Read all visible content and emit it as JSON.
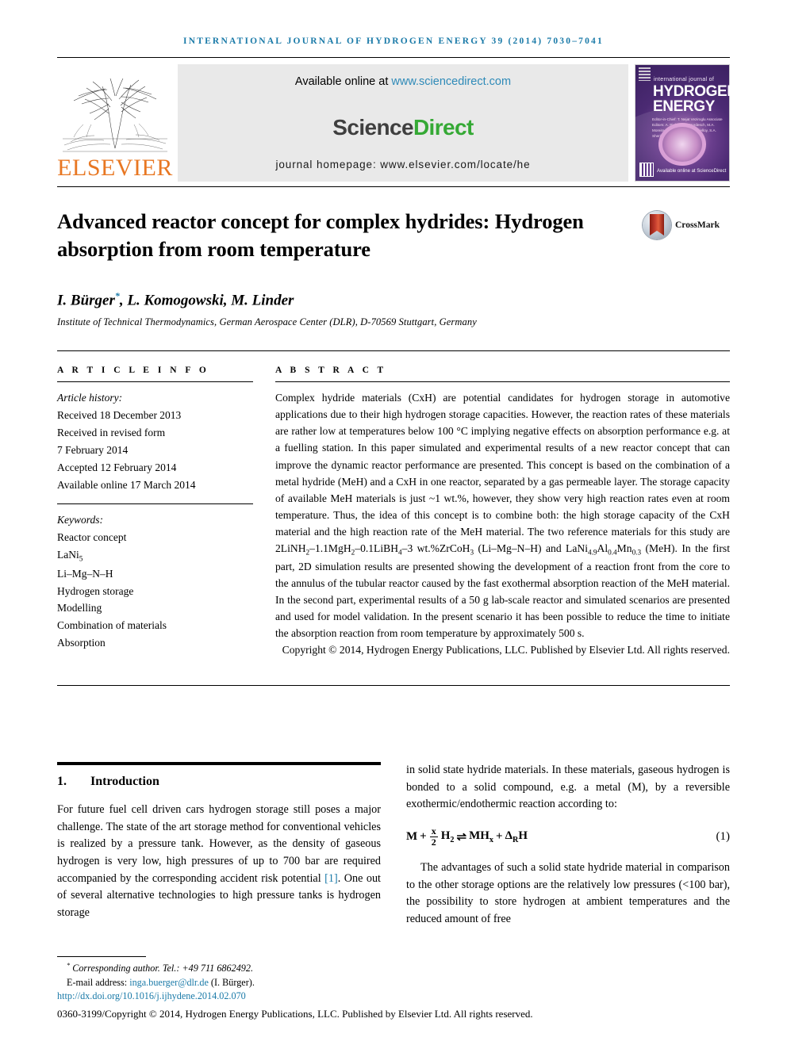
{
  "running_head": "International Journal of Hydrogen Energy 39 (2014) 7030–7041",
  "masthead": {
    "publisher_name": "ELSEVIER",
    "available_prefix": "Available online at ",
    "sciencedirect_url": "www.sciencedirect.com",
    "logo_part1": "Science",
    "logo_part2": "Direct",
    "journal_homepage": "journal homepage: www.elsevier.com/locate/he",
    "cover": {
      "line_small": "international journal of",
      "line1": "HYDROGEN",
      "line2": "ENERGY",
      "editors": "Editor-in-Chief: T. Nejat Veziroglu   Associate Editors: A. Bielsk, E.C. Kordesch, M.A. Moreira, M.Z. Pasche, J.M. Bielloy, S.A. Sherif and D.Y. Goswami",
      "sd_note": "Available online at ScienceDirect"
    }
  },
  "title": "Advanced reactor concept for complex hydrides: Hydrogen absorption from room temperature",
  "crossmark_label": "CrossMark",
  "authors": "I. Bürger",
  "authors_rest": ", L. Komogowski, M. Linder",
  "author_marker": "*",
  "affiliation": "Institute of Technical Thermodynamics, German Aerospace Center (DLR), D-70569 Stuttgart, Germany",
  "article_info": {
    "heading": "A R T I C L E   I N F O",
    "history_label": "Article history:",
    "history": [
      "Received 18 December 2013",
      "Received in revised form",
      "7 February 2014",
      "Accepted 12 February 2014",
      "Available online 17 March 2014"
    ],
    "keywords_label": "Keywords:",
    "keywords": [
      "Reactor concept",
      "LaNi5",
      "Li–Mg–N–H",
      "Hydrogen storage",
      "Modelling",
      "Combination of materials",
      "Absorption"
    ]
  },
  "abstract": {
    "heading": "A B S T R A C T",
    "body": "Complex hydride materials (CxH) are potential candidates for hydrogen storage in automotive applications due to their high hydrogen storage capacities. However, the reaction rates of these materials are rather low at temperatures below 100 °C implying negative effects on absorption performance e.g. at a fuelling station. In this paper simulated and experimental results of a new reactor concept that can improve the dynamic reactor performance are presented. This concept is based on the combination of a metal hydride (MeH) and a CxH in one reactor, separated by a gas permeable layer. The storage capacity of available MeH materials is just ~1 wt.%, however, they show very high reaction rates even at room temperature. Thus, the idea of this concept is to combine both: the high storage capacity of the CxH material and the high reaction rate of the MeH material. The two reference materials for this study are 2LiNH2–1.1MgH2–0.1LiBH4–3 wt.%ZrCoH3 (Li–Mg–N–H) and LaNi4.9Al0.4Mn0.3 (MeH). In the first part, 2D simulation results are presented showing the development of a reaction front from the core to the annulus of the tubular reactor caused by the fast exothermal absorption reaction of the MeH material. In the second part, experimental results of a 50 g lab-scale reactor and simulated scenarios are presented and used for model validation. In the present scenario it has been possible to reduce the time to initiate the absorption reaction from room temperature by approximately 500 s.",
    "copyright": "Copyright © 2014, Hydrogen Energy Publications, LLC. Published by Elsevier Ltd. All rights reserved."
  },
  "section": {
    "number": "1.",
    "title": "Introduction"
  },
  "body": {
    "left_p1_a": "For future fuel cell driven cars hydrogen storage still poses a major challenge. The state of the art storage method for conventional vehicles is realized by a pressure tank. However, as the density of gaseous hydrogen is very low, high pressures of up to 700 bar are required accompanied by the corresponding accident risk potential ",
    "left_ref": "[1]",
    "left_p1_b": ". One out of several alternative technologies to high pressure tanks is hydrogen storage",
    "right_p1": "in solid state hydride materials. In these materials, gaseous hydrogen is bonded to a solid compound, e.g. a metal (M), by a reversible exothermic/endothermic reaction according to:",
    "right_p2": "The advantages of such a solid state hydride material in comparison to the other storage options are the relatively low pressures (<100 bar), the possibility to store hydrogen at ambient temperatures and the reduced amount of free",
    "equation": {
      "m": "M",
      "plus": "+",
      "num": "x",
      "den": "2",
      "h2": "H",
      "h2sub": "2",
      "arrows": "⇌",
      "mh": "MH",
      "mhsub": "x",
      "delta": "Δ",
      "deltasub": "R",
      "deltah": "H",
      "number": "(1)"
    }
  },
  "footer": {
    "corresponding_marker": "*",
    "corresponding": "Corresponding author. Tel.: +49 711 6862492.",
    "email_label": "E-mail address: ",
    "email": "inga.buerger@dlr.de",
    "email_owner": " (I. Bürger).",
    "doi": "http://dx.doi.org/10.1016/j.ijhydene.2014.02.070",
    "issn_copy": "0360-3199/Copyright © 2014, Hydrogen Energy Publications, LLC. Published by Elsevier Ltd. All rights reserved."
  },
  "colors": {
    "link": "#1a7aa8",
    "elsevier_orange": "#E87722",
    "sciencedirect_green": "#35a935"
  }
}
